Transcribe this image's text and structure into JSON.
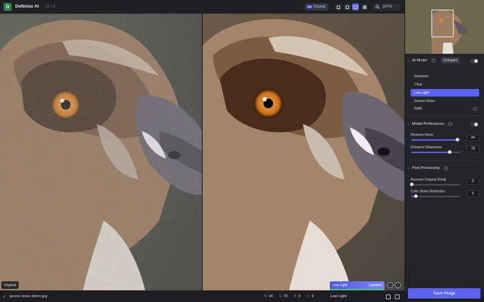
{
  "app": {
    "title": "DeNoise AI",
    "version": "v3.7.0"
  },
  "toolbar": {
    "original_button": "Original",
    "original_tag": "OR",
    "zoom_level": "167%"
  },
  "views": {
    "original_label": "Original",
    "status_model": "Low Light",
    "status_text": "Updated"
  },
  "sidebar": {
    "ai_model": {
      "title": "AI Model",
      "compare_label": "Compare",
      "help": "?",
      "models": [
        "Standard",
        "Clear",
        "Low Light",
        "Severe Noise",
        "RAW"
      ],
      "selected": "Low Light"
    },
    "model_preferences": {
      "title": "Model Preferences",
      "remove_noise_label": "Remove Noise",
      "remove_noise_value": "94",
      "remove_noise_level": 0.94,
      "enhance_sharpness_label": "Enhance Sharpness",
      "enhance_sharpness_value": "78",
      "enhance_sharpness_level": 0.78
    },
    "post_processing": {
      "title": "Post Processing",
      "recover_detail_label": "Recover Original Detail",
      "recover_detail_value": "0",
      "recover_detail_level": 0.0,
      "color_noise_label": "Color Noise Reduction",
      "color_noise_value": "9",
      "color_noise_level": 0.09
    },
    "save_button": "Save Image"
  },
  "bottombar": {
    "filename": "goose-noise-demo.jpg",
    "metrics": [
      {
        "key": "N:",
        "value": "94"
      },
      {
        "key": "S:",
        "value": "78"
      },
      {
        "key": "R:",
        "value": "0"
      },
      {
        "key": "C:",
        "value": "9"
      }
    ],
    "model_name": "Low Light"
  },
  "colors": {
    "accent": "#5b63f5",
    "success": "#48c46e",
    "panel": "#24252a",
    "background": "#1b1c20"
  },
  "icons": [
    "denoise-logo-icon",
    "single-view-icon",
    "split-view-icon",
    "side-by-side-icon",
    "quad-view-icon",
    "magnifier-icon",
    "chevron-down-icon",
    "help-icon",
    "check-icon",
    "camera-icon",
    "trash-icon"
  ]
}
